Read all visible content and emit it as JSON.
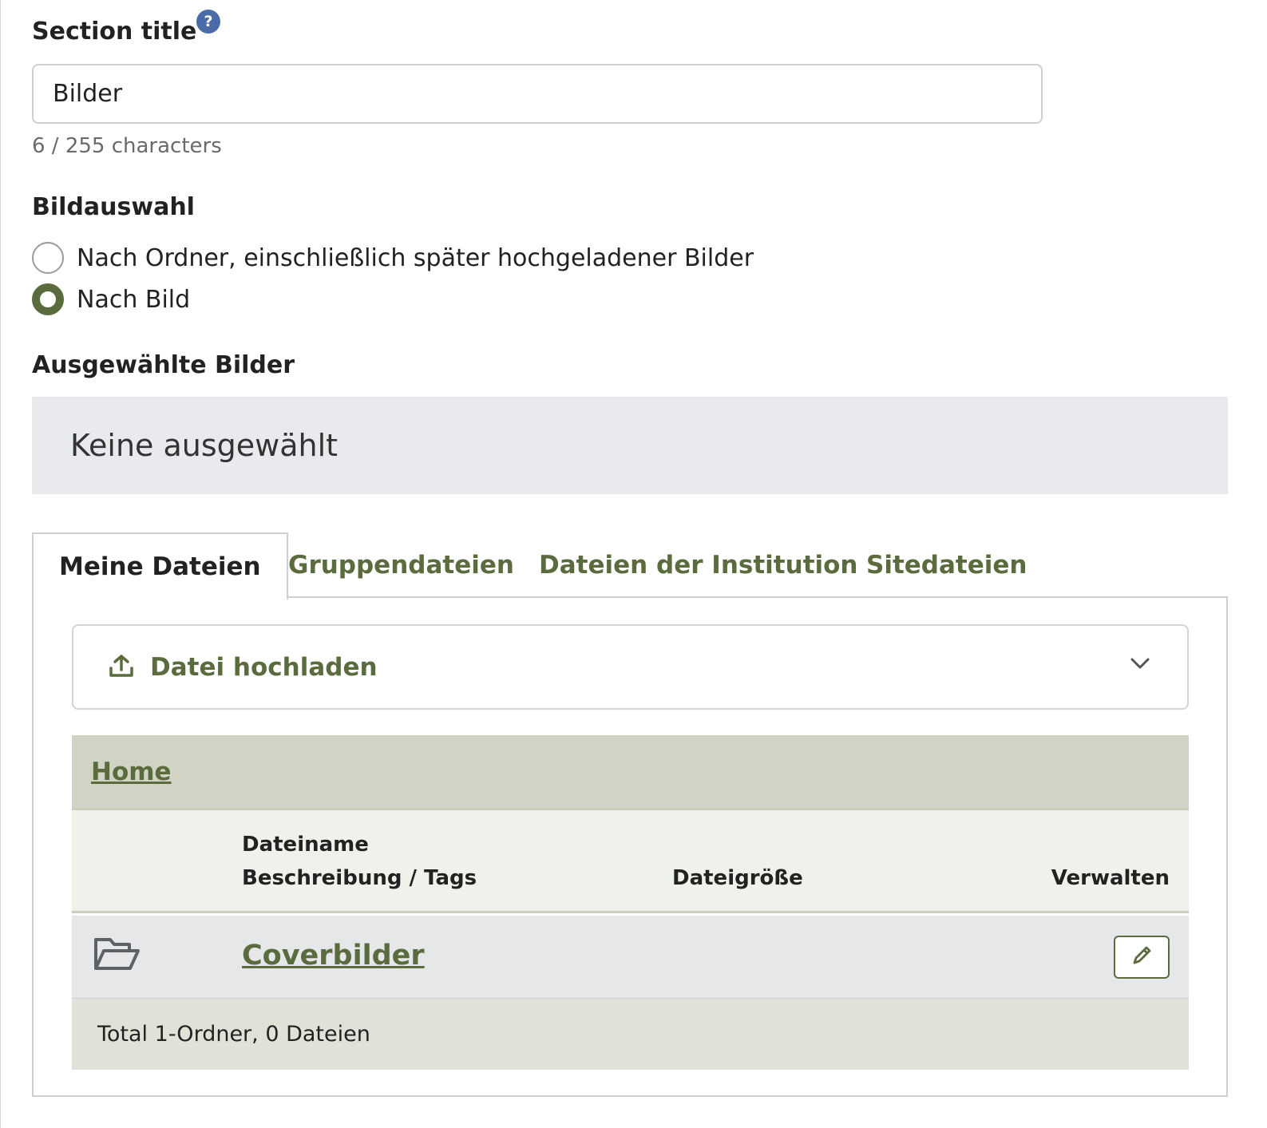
{
  "section_title": {
    "label": "Section title",
    "help_glyph": "?",
    "value": "Bilder",
    "counter": "6 / 255 characters"
  },
  "bildauswahl": {
    "label": "Bildauswahl",
    "options": [
      {
        "label": "Nach Ordner, einschließlich später hochgeladener Bilder",
        "checked": false
      },
      {
        "label": "Nach Bild",
        "checked": true
      }
    ]
  },
  "selected": {
    "label": "Ausgewählte Bilder",
    "empty_text": "Keine ausgewählt"
  },
  "tabs": [
    {
      "label": "Meine Dateien",
      "active": true
    },
    {
      "label": "Gruppendateien",
      "active": false
    },
    {
      "label": "Dateien der Institution",
      "active": false
    },
    {
      "label": "Sitedateien",
      "active": false
    }
  ],
  "upload": {
    "label": "Datei hochladen",
    "icon": "upload-icon"
  },
  "breadcrumb": {
    "home": "Home"
  },
  "table": {
    "headers": {
      "name": "Dateiname",
      "description": "Beschreibung / Tags",
      "size": "Dateigröße",
      "manage": "Verwalten"
    },
    "rows": [
      {
        "icon": "folder-icon",
        "name": "Coverbilder"
      }
    ],
    "total": "Total 1-Ordner, 0 Dateien"
  },
  "colors": {
    "accent": "#5a6b3e",
    "help": "#4a6aa8"
  }
}
